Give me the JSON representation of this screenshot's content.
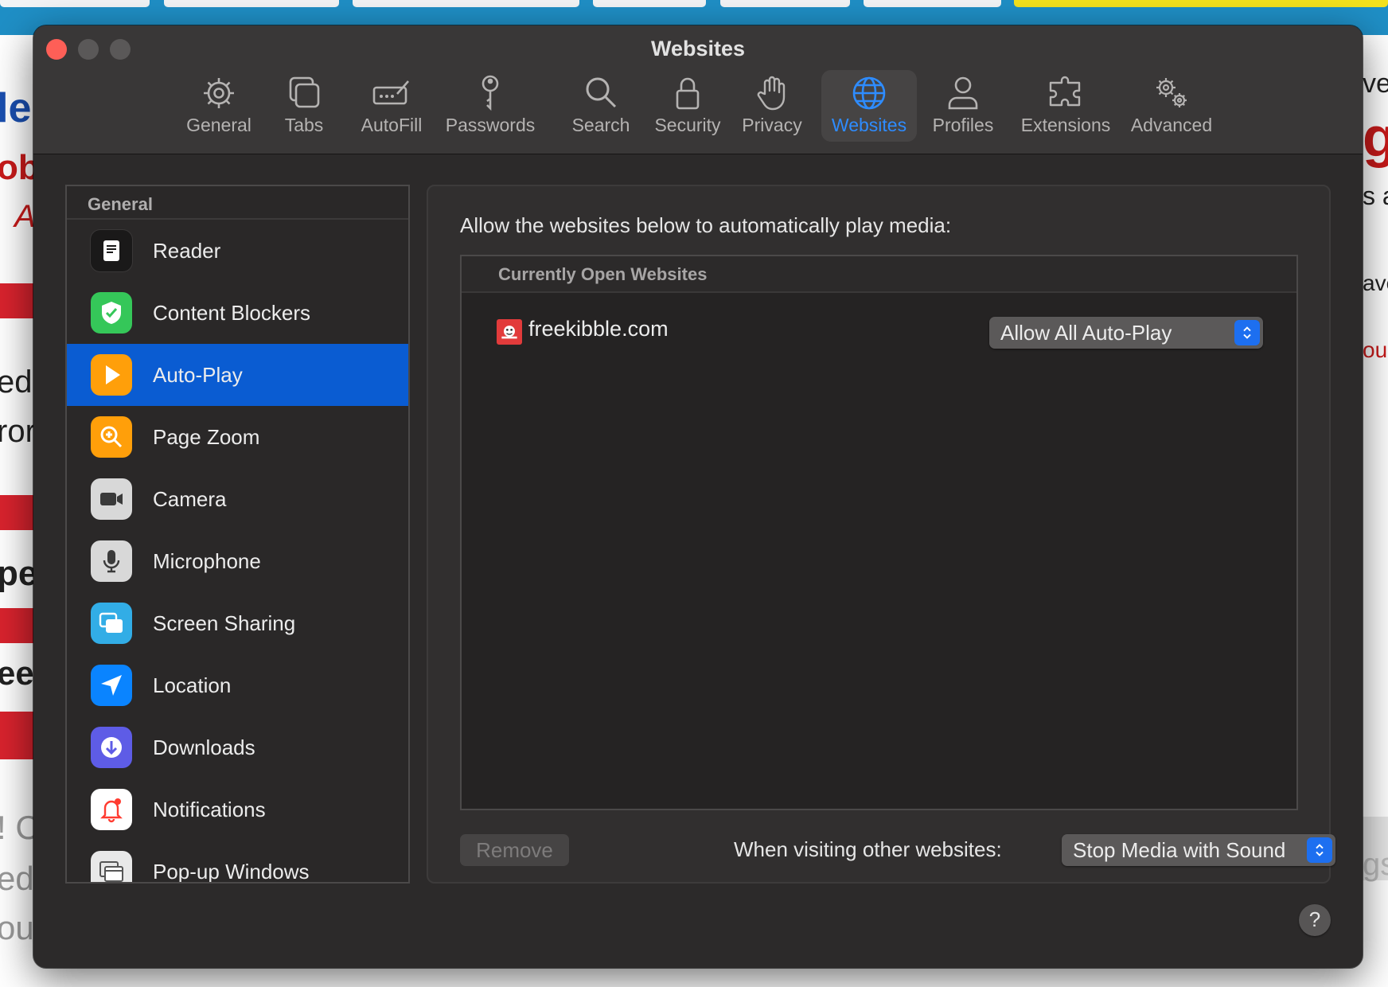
{
  "window": {
    "title": "Websites"
  },
  "toolbar": {
    "items": [
      {
        "label": "General",
        "icon": "gear-icon"
      },
      {
        "label": "Tabs",
        "icon": "tabs-icon"
      },
      {
        "label": "AutoFill",
        "icon": "autofill-icon"
      },
      {
        "label": "Passwords",
        "icon": "key-icon"
      },
      {
        "label": "Search",
        "icon": "magnifier-icon"
      },
      {
        "label": "Security",
        "icon": "lock-icon"
      },
      {
        "label": "Privacy",
        "icon": "hand-icon"
      },
      {
        "label": "Websites",
        "icon": "globe-icon",
        "active": true
      },
      {
        "label": "Profiles",
        "icon": "person-icon"
      },
      {
        "label": "Extensions",
        "icon": "puzzle-icon"
      },
      {
        "label": "Advanced",
        "icon": "gears-icon"
      }
    ]
  },
  "sidebar": {
    "header": "General",
    "items": [
      {
        "label": "Reader",
        "icon": "reader-icon"
      },
      {
        "label": "Content Blockers",
        "icon": "shield-check-icon"
      },
      {
        "label": "Auto-Play",
        "icon": "play-icon",
        "selected": true
      },
      {
        "label": "Page Zoom",
        "icon": "zoom-icon"
      },
      {
        "label": "Camera",
        "icon": "camera-icon"
      },
      {
        "label": "Microphone",
        "icon": "microphone-icon"
      },
      {
        "label": "Screen Sharing",
        "icon": "screen-sharing-icon"
      },
      {
        "label": "Location",
        "icon": "location-arrow-icon"
      },
      {
        "label": "Downloads",
        "icon": "download-icon"
      },
      {
        "label": "Notifications",
        "icon": "bell-icon"
      },
      {
        "label": "Pop-up Windows",
        "icon": "popup-windows-icon"
      }
    ]
  },
  "panel": {
    "heading": "Allow the websites below to automatically play media:",
    "table_header": "Currently Open Websites",
    "rows": [
      {
        "site": "freekibble.com",
        "setting": "Allow All Auto-Play"
      }
    ],
    "remove_label": "Remove",
    "other_label": "When visiting other websites:",
    "other_value": "Stop Media with Sound"
  },
  "help": {
    "label": "?"
  },
  "background": {
    "fragments": [
      "lel",
      "obl",
      "A",
      "ed",
      "ror",
      "pe",
      "eed",
      "! C",
      "ed",
      "ou",
      "ve",
      "g",
      "s a",
      "ave",
      "our",
      "gs"
    ]
  },
  "colors": {
    "accent": "#0a5cd2",
    "active_label": "#2e8cff",
    "close": "#fe5f57"
  }
}
